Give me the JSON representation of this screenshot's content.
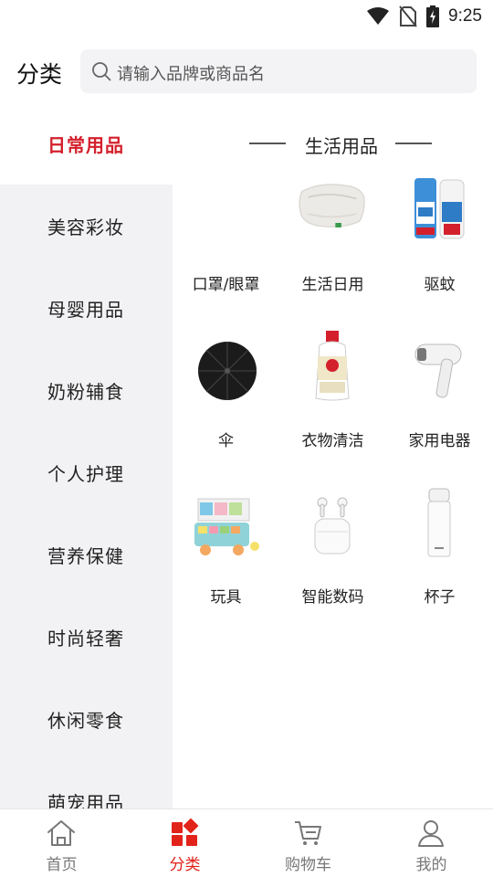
{
  "status_bar": {
    "time": "9:25"
  },
  "header": {
    "title": "分类",
    "search_placeholder": "请输入品牌或商品名"
  },
  "colors": {
    "accent": "#d4202c",
    "sidebar_bg": "#f2f2f4"
  },
  "sidebar": {
    "items": [
      {
        "label": "日常用品",
        "active": true
      },
      {
        "label": "美容彩妆"
      },
      {
        "label": "母婴用品"
      },
      {
        "label": "奶粉辅食"
      },
      {
        "label": "个人护理"
      },
      {
        "label": "营养保健"
      },
      {
        "label": "时尚轻奢"
      },
      {
        "label": "休闲零食"
      },
      {
        "label": "萌宠用品"
      }
    ]
  },
  "content": {
    "section_title": "生活用品",
    "categories": [
      {
        "label": "口罩/眼罩",
        "icon": "mask-image"
      },
      {
        "label": "生活日用",
        "icon": "pillow-image"
      },
      {
        "label": "驱蚊",
        "icon": "mosquito-repellent-image"
      },
      {
        "label": "伞",
        "icon": "umbrella-image"
      },
      {
        "label": "衣物清洁",
        "icon": "detergent-bottle-image"
      },
      {
        "label": "家用电器",
        "icon": "hair-dryer-image"
      },
      {
        "label": "玩具",
        "icon": "toy-image"
      },
      {
        "label": "智能数码",
        "icon": "earbuds-image"
      },
      {
        "label": "杯子",
        "icon": "thermos-cup-image"
      }
    ]
  },
  "bottom_nav": {
    "items": [
      {
        "label": "首页",
        "icon": "home-icon"
      },
      {
        "label": "分类",
        "icon": "category-icon",
        "active": true
      },
      {
        "label": "购物车",
        "icon": "cart-icon"
      },
      {
        "label": "我的",
        "icon": "user-icon"
      }
    ]
  }
}
